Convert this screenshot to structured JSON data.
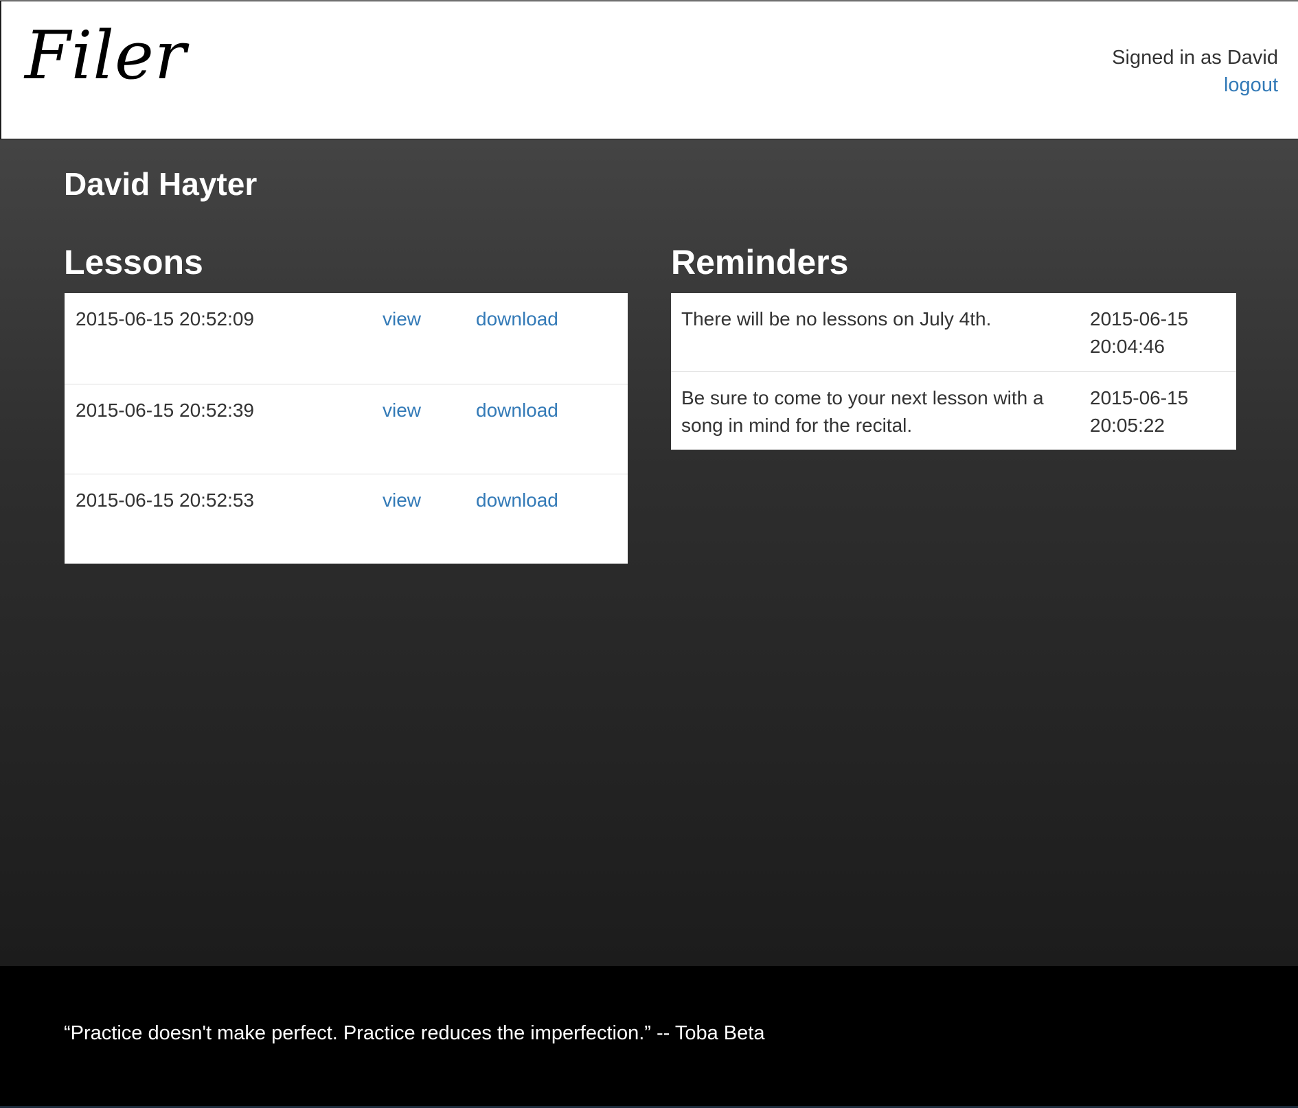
{
  "header": {
    "logo": "Filer",
    "signed_in_text": "Signed in as David",
    "logout_label": "logout"
  },
  "student": {
    "name": "David Hayter"
  },
  "lessons": {
    "title": "Lessons",
    "rows": [
      {
        "date": "2015-06-15 20:52:09",
        "view_label": "view",
        "download_label": "download"
      },
      {
        "date": "2015-06-15 20:52:39",
        "view_label": "view",
        "download_label": "download"
      },
      {
        "date": "2015-06-15 20:52:53",
        "view_label": "view",
        "download_label": "download"
      }
    ]
  },
  "reminders": {
    "title": "Reminders",
    "rows": [
      {
        "text": "There will be no lessons on July 4th.",
        "date_line1": "2015-06-15",
        "date_line2": "20:04:46"
      },
      {
        "text": "Be sure to come to your next lesson with a song in mind for the recital.",
        "date_line1": "2015-06-15",
        "date_line2": "20:05:22"
      }
    ]
  },
  "footer": {
    "quote": "“Practice doesn't make perfect. Practice reduces the imperfection.” -- Toba Beta"
  },
  "colors": {
    "link": "#337ab7",
    "text": "#333333",
    "background_top": "#444444",
    "background_bottom": "#1c1c1c"
  }
}
